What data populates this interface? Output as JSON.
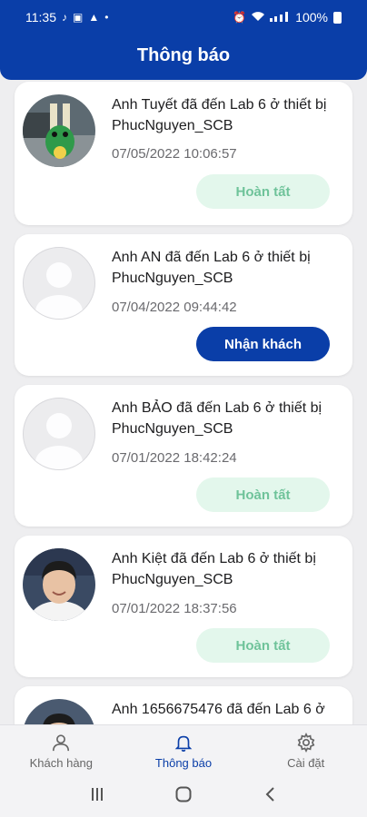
{
  "status": {
    "time": "11:35",
    "battery": "100%"
  },
  "header": {
    "title": "Thông báo"
  },
  "notifications": [
    {
      "message": "Anh Tuyết đã đến Lab 6 ở thiết bị PhucNguyen_SCB",
      "time": "07/05/2022 10:06:57",
      "action": "Hoàn tất",
      "avatar": "photo"
    },
    {
      "message": "Anh AN đã đến Lab 6 ở thiết bị PhucNguyen_SCB",
      "time": "07/04/2022 09:44:42",
      "action": "Nhận khách",
      "avatar": "placeholder"
    },
    {
      "message": "Anh BẢO đã đến Lab 6 ở thiết bị PhucNguyen_SCB",
      "time": "07/01/2022 18:42:24",
      "action": "Hoàn tất",
      "avatar": "placeholder"
    },
    {
      "message": "Anh Kiệt đã đến Lab 6 ở thiết bị PhucNguyen_SCB",
      "time": "07/01/2022 18:37:56",
      "action": "Hoàn tất",
      "avatar": "photo"
    },
    {
      "message": "Anh 1656675476 đã đến Lab 6 ở",
      "avatar": "photo"
    }
  ],
  "bottom_nav": {
    "customers": "Khách hàng",
    "notifications": "Thông báo",
    "settings": "Cài đặt"
  },
  "colors": {
    "primary": "#0a3ea8",
    "done_bg": "#e3f7ec",
    "done_text": "#6fc39a"
  },
  "icons": {
    "customers": "person-icon",
    "notifications": "bell-icon",
    "settings": "gear-icon"
  }
}
